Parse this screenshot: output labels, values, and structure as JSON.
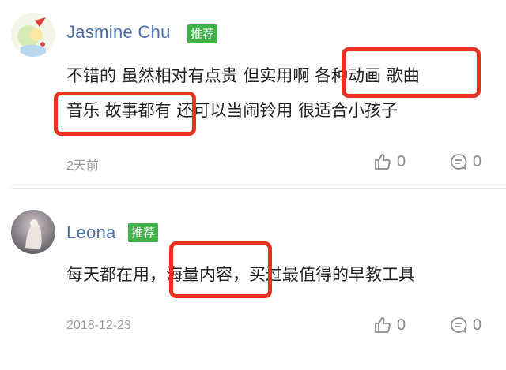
{
  "comments": [
    {
      "user": "Jasmine Chu",
      "badge": "推荐",
      "line1": "不错的  虽然相对有点贵  但实用啊  各种动画  歌曲",
      "line2": "音乐  故事都有  还可以当闹铃用  很适合小孩子",
      "date": "2天前",
      "likes": "0",
      "replies": "0"
    },
    {
      "user": "Leona",
      "badge": "推荐",
      "line1": "每天都在用，海量内容，买过最值得的早教工具",
      "date": "2018-12-23",
      "likes": "0",
      "replies": "0"
    }
  ],
  "colors": {
    "highlight": "#e8321e",
    "badge": "#3fb24a",
    "username": "#4b6ea8"
  }
}
